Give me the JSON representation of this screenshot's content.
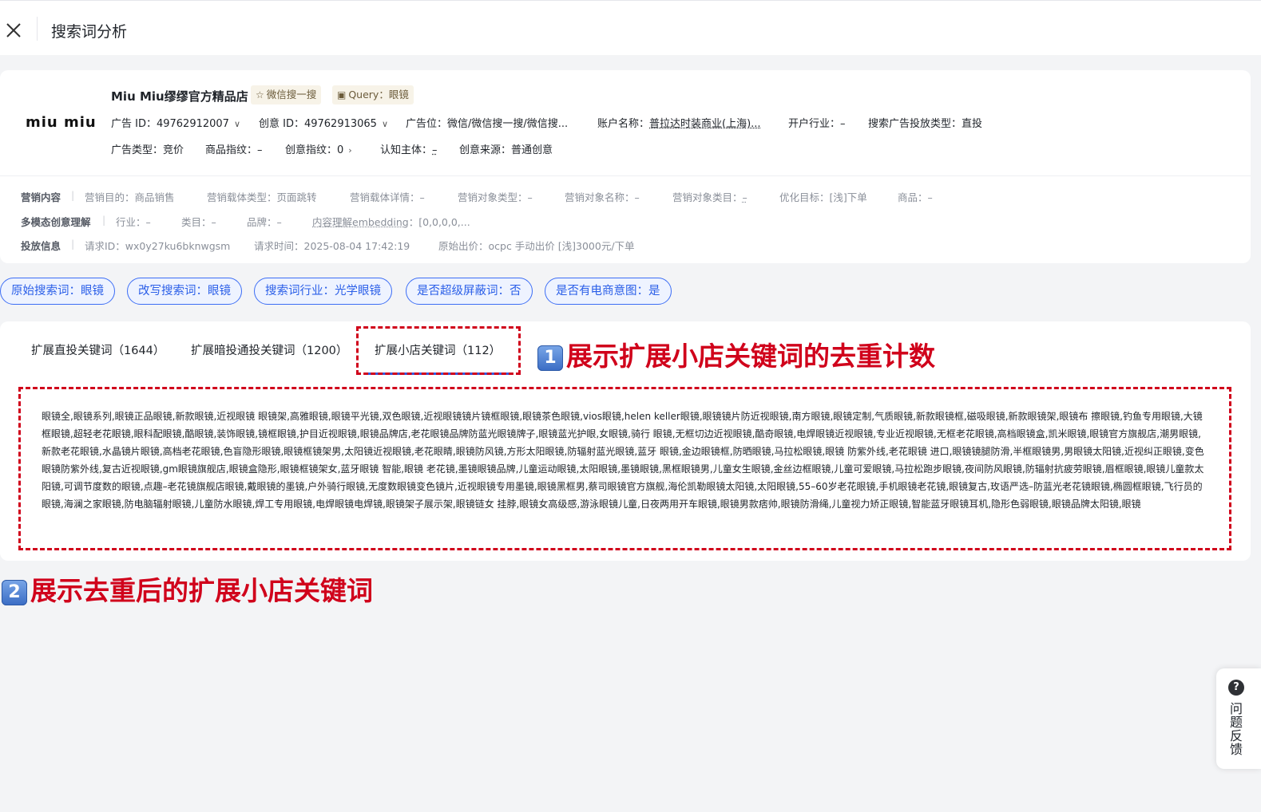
{
  "header": {
    "title": "搜索词分析"
  },
  "store": {
    "logo_text": "miu miu",
    "name": "Miu Miu缪缪官方精品店",
    "tag_search": "微信搜一搜",
    "tag_query": "Query：眼镜",
    "ad_id": "广告 ID：49762912007",
    "creative_id": "创意 ID：49762913065",
    "ad_position": "广告位：微信/微信搜一搜/微信搜...",
    "account_label": "账户名称：",
    "account_value": "普拉达时装商业(上海)...",
    "industry": "开户行业：–",
    "delivery_type": "搜索广告投放类型：直投",
    "ad_type": "广告类型：竞价",
    "product_index": "商品指纹：–",
    "creative_index": "创意指纹：0",
    "subject_label": "认知主体：",
    "subject_value": "–",
    "creative_source": "创意来源：普通创意"
  },
  "marketing": {
    "label": "营销内容",
    "purpose": "营销目的：商品销售",
    "carrier_type": "营销载体类型：页面跳转",
    "carrier_detail": "营销载体详情：–",
    "object_type": "营销对象类型：–",
    "object_name": "营销对象名称：–",
    "object_category_label": "营销对象类目：",
    "object_category_value": "–",
    "optimize_goal": "优化目标：[浅]下单",
    "product": "商品：–"
  },
  "multimodal": {
    "label": "多模态创意理解",
    "industry": "行业：–",
    "category": "类目：–",
    "brand": "品牌：–",
    "embedding_label": "内容理解embedding",
    "embedding_value": "：[0,0,0,0,..."
  },
  "delivery": {
    "label": "投放信息",
    "request_id": "请求ID：wx0y27ku6bknwgsm",
    "request_time": "请求时间：2025-08-04 17:42:19",
    "bid": "原始出价：ocpc 手动出价 [浅]3000元/下单"
  },
  "pills": [
    "原始搜索词：眼镜",
    "改写搜索词：眼镜",
    "搜索词行业：光学眼镜",
    "是否超级屏蔽词：否",
    "是否有电商意图：是"
  ],
  "tabs": [
    "扩展直投关键词（1644）",
    "扩展暗投通投关键词（1200）",
    "扩展小店关键词（112）"
  ],
  "keywords": "眼镜全,眼镜系列,眼镜正品眼镜,新款眼镜,近视眼镜 眼镜架,高雅眼镜,眼镜平光镜,双色眼镜,近视眼镜镜片镜框眼镜,眼镜茶色眼镜,vios眼镜,helen keller眼镜,眼镜镜片防近视眼镜,南方眼镜,眼镜定制,气质眼镜,新款眼镜框,磁吸眼镜,新款眼镜架,眼镜布 擦眼镜,钓鱼专用眼镜,大镜框眼镜,超轻老花眼镜,眼科配眼镜,酷眼镜,装饰眼镜,镜框眼镜,护目近视眼镜,眼镜品牌店,老花眼镜品牌防蓝光眼镜牌子,眼镜蓝光护眼,女眼镜,骑行 眼镜,无框切边近视眼镜,酷奇眼镜,电焊眼镜近视眼镜,专业近视眼镜,无框老花眼镜,高档眼镜盒,凯米眼镜,眼镜官方旗舰店,潮男眼镜,新款老花眼镜,水晶镜片眼镜,高档老花眼镜,色盲隐形眼镜,眼镜框镜架男,太阳镜近视眼镜,老花眼睛,眼镜防风镜,方形太阳眼镜,防辐射蓝光眼镜,蓝牙 眼镜,金边眼镜框,防晒眼镜,马拉松眼镜,眼镜 防紫外线,老花眼镜 进口,眼镜镜腿防滑,半框眼镜男,男眼镜太阳镜,近视纠正眼镜,变色眼镜防紫外线,复古近视眼镜,gm眼镜旗舰店,眼镜盒隐形,眼镜框镜架女,蓝牙眼镜 智能,眼镜 老花镜,墨镜眼镜品牌,儿童运动眼镜,太阳眼镜,墨镜眼镜,黑框眼镜男,儿童女生眼镜,金丝边框眼镜,儿童可爱眼镜,马拉松跑步眼镜,夜间防风眼镜,防辐射抗疲劳眼镜,眉框眼镜,眼镜儿童款太阳镜,可调节度数的眼镜,点趣–老花镜旗舰店眼镜,戴眼镜的墨镜,户外骑行眼镜,无度数眼镜变色镜片,近视眼镜专用墨镜,眼镜黑框男,蔡司眼镜官方旗舰,海伦凯勒眼镜太阳镜,太阳眼镜,55–60岁老花眼镜,手机眼镜老花镜,眼镜复古,玫语严选–防蓝光老花镜眼镜,椭圆框眼镜,飞行员的眼镜,海澜之家眼镜,防电脑辐射眼镜,儿童防水眼镜,焊工专用眼镜,电焊眼镜电焊镜,眼镜架子展示架,眼镜链女 挂脖,眼镜女高级感,游泳眼镜儿童,日夜两用开车眼镜,眼镜男款痞帅,眼镜防滑绳,儿童视力矫正眼镜,智能蓝牙眼镜耳机,隐形色弱眼镜,眼镜品牌太阳镜,眼镜",
  "annotations": {
    "a1_num": "1",
    "a1_text": "展示扩展小店关键词的去重计数",
    "a2_num": "2",
    "a2_text": "展示去重后的扩展小店关键词"
  },
  "feedback": {
    "icon": "?",
    "label": "问题反馈"
  },
  "colors": {
    "accent": "#2b5fe8",
    "annotation_red": "#d0021b"
  }
}
